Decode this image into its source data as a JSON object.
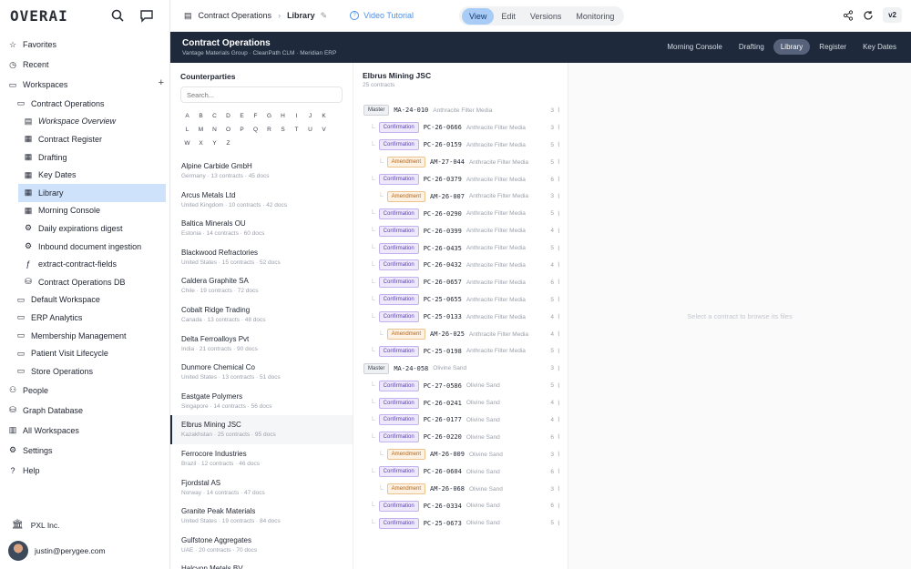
{
  "app": {
    "logo": "OVERAI"
  },
  "sidebar": {
    "items": [
      {
        "label": "Favorites",
        "icon": "star-icon",
        "level": 0
      },
      {
        "label": "Recent",
        "icon": "clock-icon",
        "level": 0
      },
      {
        "label": "Workspaces",
        "icon": "folder-icon",
        "level": 0
      },
      {
        "label": "Contract Operations",
        "icon": "folder-icon",
        "level": 1
      },
      {
        "label": "Workspace Overview",
        "icon": "book-icon",
        "level": 2
      },
      {
        "label": "Contract Register",
        "icon": "table-icon",
        "level": 2
      },
      {
        "label": "Drafting",
        "icon": "table-icon",
        "level": 2
      },
      {
        "label": "Key Dates",
        "icon": "table-icon",
        "level": 2
      },
      {
        "label": "Library",
        "icon": "table-icon",
        "level": 2
      },
      {
        "label": "Morning Console",
        "icon": "table-icon",
        "level": 2
      },
      {
        "label": "Daily expirations digest",
        "icon": "gear-icon",
        "level": 2
      },
      {
        "label": "Inbound document ingestion",
        "icon": "gear-icon",
        "level": 2
      },
      {
        "label": "extract-contract-fields",
        "icon": "function-icon",
        "level": 2
      },
      {
        "label": "Contract Operations DB",
        "icon": "database-icon",
        "level": 2
      },
      {
        "label": "Default Workspace",
        "icon": "folder-icon",
        "level": 1
      },
      {
        "label": "ERP Analytics",
        "icon": "folder-icon",
        "level": 1
      },
      {
        "label": "Membership Management",
        "icon": "folder-icon",
        "level": 1
      },
      {
        "label": "Patient Visit Lifecycle",
        "icon": "folder-icon",
        "level": 1
      },
      {
        "label": "Store Operations",
        "icon": "folder-icon",
        "level": 1
      },
      {
        "label": "People",
        "icon": "people-icon",
        "level": 0
      },
      {
        "label": "Graph Database",
        "icon": "database-icon",
        "level": 0
      },
      {
        "label": "All Workspaces",
        "icon": "building-icon",
        "level": 0
      },
      {
        "label": "Settings",
        "icon": "gear-icon",
        "level": 0
      },
      {
        "label": "Help",
        "icon": "help-icon",
        "level": 0
      }
    ],
    "org": "PXL Inc.",
    "user": "justin@perygee.com"
  },
  "topbar": {
    "crumb_workspace": "Contract Operations",
    "crumb_page": "Library",
    "video": "Video Tutorial",
    "modes": [
      "View",
      "Edit",
      "Versions",
      "Monitoring"
    ],
    "version": "v2"
  },
  "band": {
    "title": "Contract Operations",
    "subtitle": "Vantage Materials Group · CleanPath CLM · Meridian ERP",
    "tabs": [
      "Morning Console",
      "Drafting",
      "Library",
      "Register",
      "Key Dates"
    ]
  },
  "counterparties": {
    "title": "Counterparties",
    "search_placeholder": "Search...",
    "letters": [
      "A",
      "B",
      "C",
      "D",
      "E",
      "F",
      "G",
      "H",
      "I",
      "J",
      "K",
      "L",
      "M",
      "N",
      "O",
      "P",
      "Q",
      "R",
      "S",
      "T",
      "U",
      "V",
      "W",
      "X",
      "Y",
      "Z"
    ],
    "items": [
      {
        "name": "Alpine Carbide GmbH",
        "meta": "Germany · 13 contracts · 45 docs"
      },
      {
        "name": "Arcus Metals Ltd",
        "meta": "United Kingdom · 10 contracts · 42 docs"
      },
      {
        "name": "Baltica Minerals OU",
        "meta": "Estonia · 14 contracts · 60 docs"
      },
      {
        "name": "Blackwood Refractories",
        "meta": "United States · 15 contracts · 52 docs"
      },
      {
        "name": "Caldera Graphite SA",
        "meta": "Chile · 19 contracts · 72 docs"
      },
      {
        "name": "Cobalt Ridge Trading",
        "meta": "Canada · 13 contracts · 48 docs"
      },
      {
        "name": "Delta Ferroalloys Pvt",
        "meta": "India · 21 contracts · 90 docs"
      },
      {
        "name": "Dunmore Chemical Co",
        "meta": "United States · 13 contracts · 51 docs"
      },
      {
        "name": "Eastgate Polymers",
        "meta": "Singapore · 14 contracts · 56 docs"
      },
      {
        "name": "Elbrus Mining JSC",
        "meta": "Kazakhstan · 25 contracts · 95 docs"
      },
      {
        "name": "Ferrocore Industries",
        "meta": "Brazil · 12 contracts · 46 docs"
      },
      {
        "name": "Fjordstal AS",
        "meta": "Norway · 14 contracts · 47 docs"
      },
      {
        "name": "Granite Peak Materials",
        "meta": "United States · 19 contracts · 84 docs"
      },
      {
        "name": "Gulfstone Aggregates",
        "meta": "UAE · 20 contracts · 70 docs"
      },
      {
        "name": "Halcyon Metals BV",
        "meta": ""
      }
    ]
  },
  "contracts": {
    "title": "Elbrus Mining JSC",
    "count": "25 contracts",
    "rows": [
      {
        "type": "Master",
        "code": "MA-24-010",
        "party": "Anthracite Filter Media",
        "docs": "3",
        "depth": 0
      },
      {
        "type": "Confirmation",
        "code": "PC-26-0666",
        "party": "Anthracite Filter Media",
        "docs": "3",
        "depth": 1
      },
      {
        "type": "Confirmation",
        "code": "PC-26-0159",
        "party": "Anthracite Filter Media",
        "docs": "5",
        "depth": 1
      },
      {
        "type": "Amendment",
        "code": "AM-27-044",
        "party": "Anthracite Filter Media",
        "docs": "5",
        "depth": 2
      },
      {
        "type": "Confirmation",
        "code": "PC-26-0379",
        "party": "Anthracite Filter Media",
        "docs": "6",
        "depth": 1
      },
      {
        "type": "Amendment",
        "code": "AM-26-007",
        "party": "Anthracite Filter Media",
        "docs": "3",
        "depth": 2
      },
      {
        "type": "Confirmation",
        "code": "PC-26-0290",
        "party": "Anthracite Filter Media",
        "docs": "5",
        "depth": 1
      },
      {
        "type": "Confirmation",
        "code": "PC-26-0399",
        "party": "Anthracite Filter Media",
        "docs": "4",
        "depth": 1
      },
      {
        "type": "Confirmation",
        "code": "PC-26-0435",
        "party": "Anthracite Filter Media",
        "docs": "5",
        "depth": 1
      },
      {
        "type": "Confirmation",
        "code": "PC-26-0432",
        "party": "Anthracite Filter Media",
        "docs": "4",
        "depth": 1
      },
      {
        "type": "Confirmation",
        "code": "PC-26-0657",
        "party": "Anthracite Filter Media",
        "docs": "6",
        "depth": 1
      },
      {
        "type": "Confirmation",
        "code": "PC-25-0655",
        "party": "Anthracite Filter Media",
        "docs": "5",
        "depth": 1
      },
      {
        "type": "Confirmation",
        "code": "PC-25-0133",
        "party": "Anthracite Filter Media",
        "docs": "4",
        "depth": 1
      },
      {
        "type": "Amendment",
        "code": "AM-26-025",
        "party": "Anthracite Filter Media",
        "docs": "4",
        "depth": 2
      },
      {
        "type": "Confirmation",
        "code": "PC-25-0198",
        "party": "Anthracite Filter Media",
        "docs": "5",
        "depth": 1
      },
      {
        "type": "Master",
        "code": "MA-24-058",
        "party": "Olivine Sand",
        "docs": "3",
        "depth": 0
      },
      {
        "type": "Confirmation",
        "code": "PC-27-0586",
        "party": "Olivine Sand",
        "docs": "5",
        "depth": 1
      },
      {
        "type": "Confirmation",
        "code": "PC-26-0241",
        "party": "Olivine Sand",
        "docs": "4",
        "depth": 1
      },
      {
        "type": "Confirmation",
        "code": "PC-26-0177",
        "party": "Olivine Sand",
        "docs": "4",
        "depth": 1
      },
      {
        "type": "Confirmation",
        "code": "PC-26-0220",
        "party": "Olivine Sand",
        "docs": "6",
        "depth": 1
      },
      {
        "type": "Amendment",
        "code": "AM-26-009",
        "party": "Olivine Sand",
        "docs": "3",
        "depth": 2
      },
      {
        "type": "Confirmation",
        "code": "PC-26-0604",
        "party": "Olivine Sand",
        "docs": "6",
        "depth": 1
      },
      {
        "type": "Amendment",
        "code": "AM-26-068",
        "party": "Olivine Sand",
        "docs": "3",
        "depth": 2
      },
      {
        "type": "Confirmation",
        "code": "PC-26-0334",
        "party": "Olivine Sand",
        "docs": "6",
        "depth": 1
      },
      {
        "type": "Confirmation",
        "code": "PC-25-0673",
        "party": "Olivine Sand",
        "docs": "5",
        "depth": 1
      }
    ]
  },
  "empty_state": "Select a contract to browse its files",
  "colors": {
    "accent": "#4b90e8",
    "band": "#1e2a3b",
    "active_nav": "#cfe2fb"
  }
}
